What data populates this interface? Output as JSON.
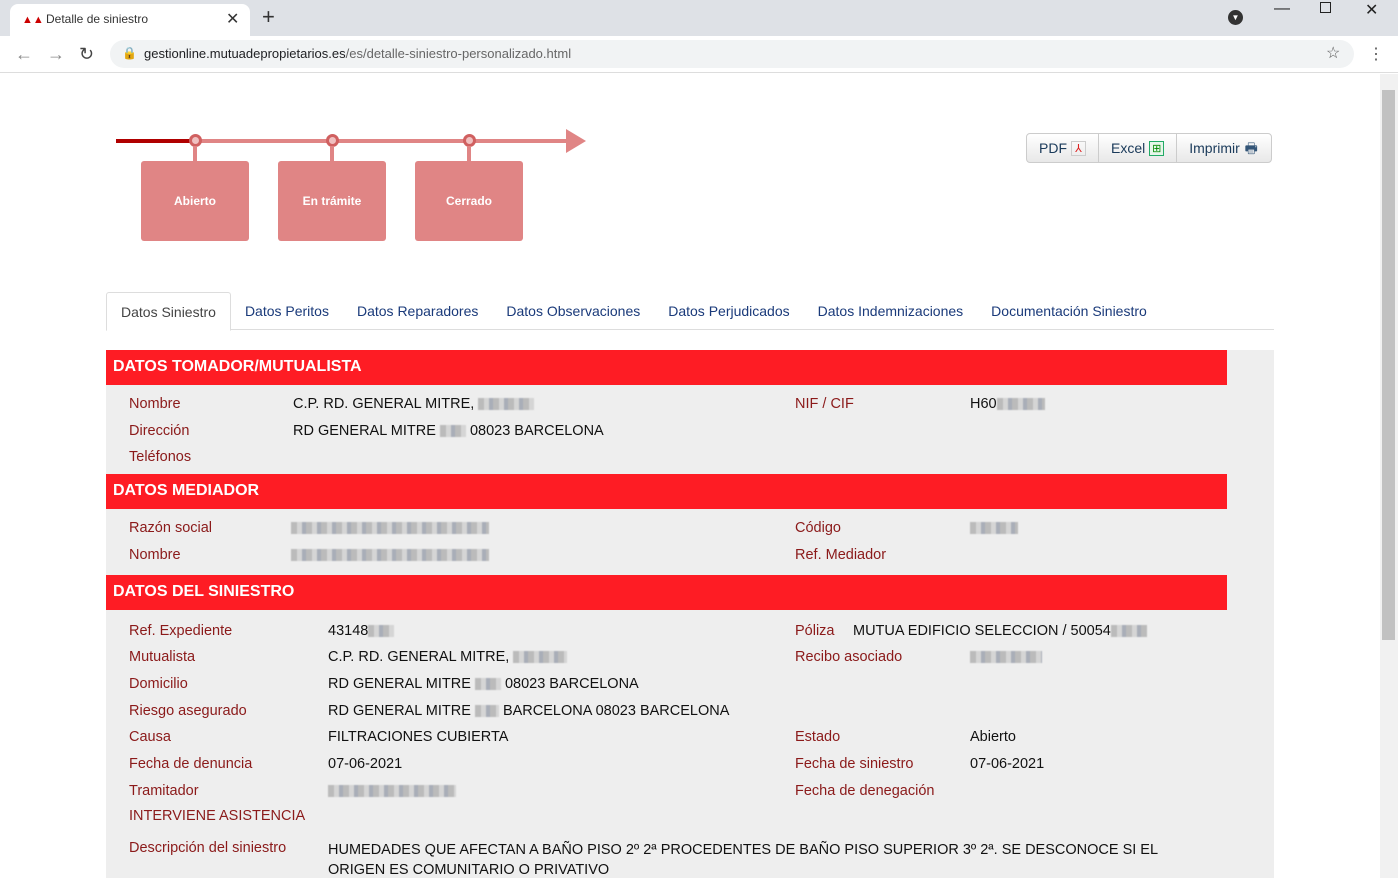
{
  "browser": {
    "tab_title": "Detalle de siniestro",
    "url_host": "gestionline.mutuadepropietarios.es",
    "url_path": "/es/detalle-siniestro-personalizado.html"
  },
  "timeline": {
    "steps": [
      "Abierto",
      "En trámite",
      "Cerrado"
    ],
    "current_step": 1
  },
  "export": {
    "pdf": "PDF",
    "excel": "Excel",
    "print": "Imprimir"
  },
  "tabs": [
    "Datos Siniestro",
    "Datos Peritos",
    "Datos Reparadores",
    "Datos Observaciones",
    "Datos Perjudicados",
    "Datos Indemnizaciones",
    "Documentación Siniestro"
  ],
  "tomador": {
    "title": "DATOS TOMADOR/MUTUALISTA",
    "nombre_label": "Nombre",
    "nombre": "C.P. RD. GENERAL MITRE,",
    "direccion_label": "Dirección",
    "direccion_a": "RD GENERAL MITRE",
    "direccion_b": "08023 BARCELONA",
    "telefonos_label": "Teléfonos",
    "nif_label": "NIF / CIF",
    "nif": "H60"
  },
  "mediador": {
    "title": "DATOS MEDIADOR",
    "razon_label": "Razón social",
    "nombre_label": "Nombre",
    "codigo_label": "Código",
    "ref_label": "Ref. Mediador"
  },
  "siniestro": {
    "title": "DATOS DEL SINIESTRO",
    "ref_label": "Ref. Expediente",
    "ref": "43148",
    "mutualista_label": "Mutualista",
    "mutualista": "C.P. RD. GENERAL MITRE,",
    "domicilio_label": "Domicilio",
    "domicilio_a": "RD GENERAL MITRE",
    "domicilio_b": "08023 BARCELONA",
    "riesgo_label": "Riesgo asegurado",
    "riesgo_a": "RD GENERAL MITRE",
    "riesgo_b": "BARCELONA 08023 BARCELONA",
    "causa_label": "Causa",
    "causa": "FILTRACIONES CUBIERTA",
    "fecha_denuncia_label": "Fecha de denuncia",
    "fecha_denuncia": "07-06-2021",
    "tramitador_label": "Tramitador",
    "asistencia": "INTERVIENE ASISTENCIA",
    "descripcion_label": "Descripción del siniestro",
    "descripcion": "HUMEDADES QUE AFECTAN A BAÑO PISO 2º 2ª PROCEDENTES DE BAÑO PISO SUPERIOR 3º 2ª. SE DESCONOCE SI EL ORIGEN ES COMUNITARIO O PRIVATIVO",
    "poliza_label": "Póliza",
    "poliza": "MUTUA EDIFICIO SELECCION / 50054",
    "recibo_label": "Recibo asociado",
    "estado_label": "Estado",
    "estado": "Abierto",
    "fecha_siniestro_label": "Fecha de siniestro",
    "fecha_siniestro": "07-06-2021",
    "fecha_denegacion_label": "Fecha de denegación"
  }
}
